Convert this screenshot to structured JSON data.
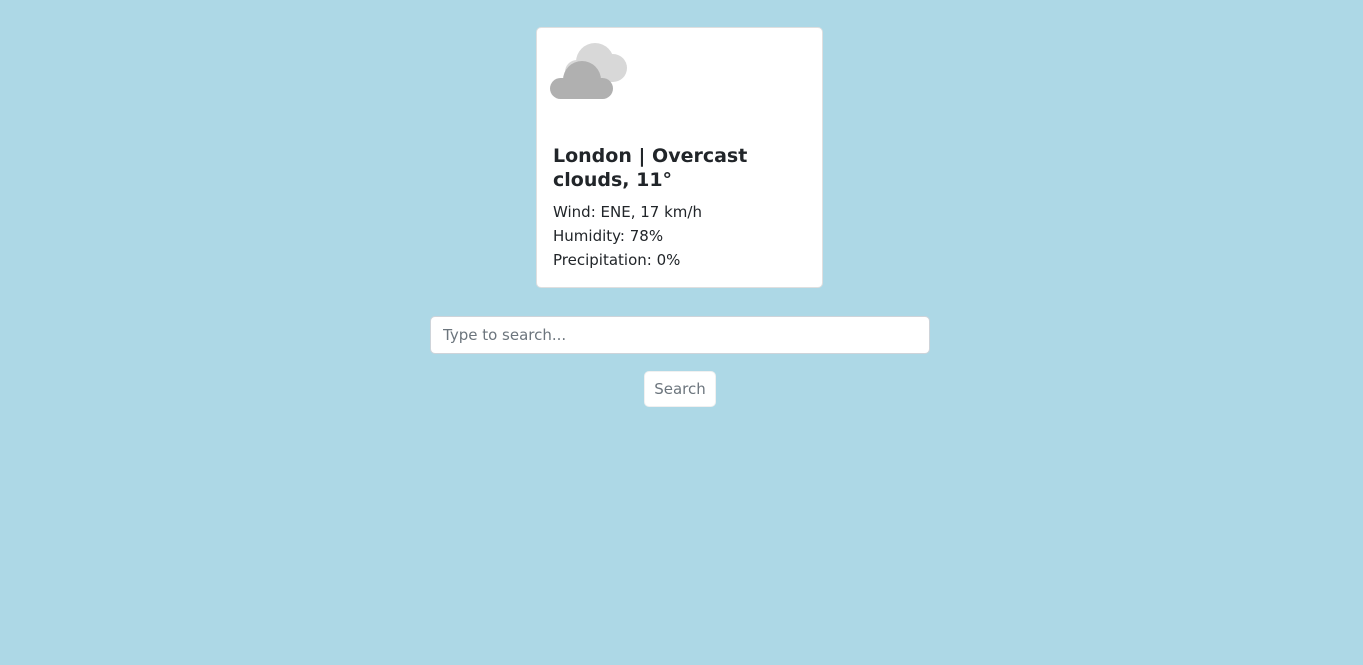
{
  "weather": {
    "icon": "overcast-clouds-icon",
    "title": "London | Overcast clouds, 11°",
    "wind": "Wind: ENE, 17 km/h",
    "humidity": "Humidity: 78%",
    "precipitation": "Precipitation: 0%"
  },
  "search": {
    "placeholder": "Type to search...",
    "value": "",
    "button_label": "Search"
  },
  "colors": {
    "background": "#add8e6",
    "cloud_front": "#b0b0b0",
    "cloud_back": "#d8d8d8"
  }
}
